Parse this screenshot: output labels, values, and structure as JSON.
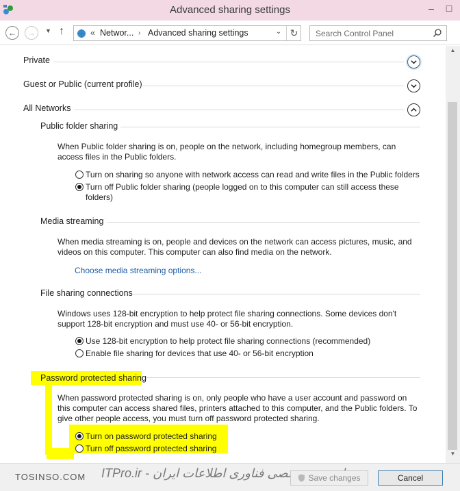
{
  "window": {
    "title": "Advanced sharing settings"
  },
  "address": {
    "chevron": "«",
    "crumbs": [
      "Networ...",
      "Advanced sharing settings"
    ],
    "separator": "›"
  },
  "search": {
    "placeholder": "Search Control Panel"
  },
  "profiles": [
    {
      "label": "Private",
      "state": "collapsed"
    },
    {
      "label": "Guest or Public (current profile)",
      "state": "collapsed"
    },
    {
      "label": "All Networks",
      "state": "expanded"
    }
  ],
  "sections": {
    "public_folder": {
      "title": "Public folder sharing",
      "desc": "When Public folder sharing is on, people on the network, including homegroup members, can access files in the Public folders.",
      "options": [
        {
          "label": "Turn on sharing so anyone with network access can read and write files in the Public folders",
          "selected": false
        },
        {
          "label": "Turn off Public folder sharing (people logged on to this computer can still access these folders)",
          "selected": true
        }
      ]
    },
    "media": {
      "title": "Media streaming",
      "desc": "When media streaming is on, people and devices on the network can access pictures, music, and videos on this computer. This computer can also find media on the network.",
      "link": "Choose media streaming options..."
    },
    "file_sharing": {
      "title": "File sharing connections",
      "desc": "Windows uses 128-bit encryption to help protect file sharing connections. Some devices don't support 128-bit encryption and must use 40- or 56-bit encryption.",
      "options": [
        {
          "label": "Use 128-bit encryption to help protect file sharing connections (recommended)",
          "selected": true
        },
        {
          "label": "Enable file sharing for devices that use 40- or 56-bit encryption",
          "selected": false
        }
      ]
    },
    "password": {
      "title": "Password protected sharing",
      "desc": "When password protected sharing is on, only people who have a user account and password on this computer can access shared files, printers attached to this computer, and the Public folders. To give other people access, you must turn off password protected sharing.",
      "options": [
        {
          "label": "Turn on password protected sharing",
          "selected": true
        },
        {
          "label": "Turn off password protected sharing",
          "selected": false
        }
      ]
    }
  },
  "footer": {
    "save_label": "Save changes",
    "cancel_label": "Cancel",
    "watermark_left": "TOSINSO.COM",
    "watermark_right": "ITPro.ir - انجمن تخصصی فناوری اطلاعات ایران"
  },
  "colors": {
    "titlebar": "#f2d9e3",
    "link": "#1f5da8",
    "highlight": "#ffff00"
  }
}
